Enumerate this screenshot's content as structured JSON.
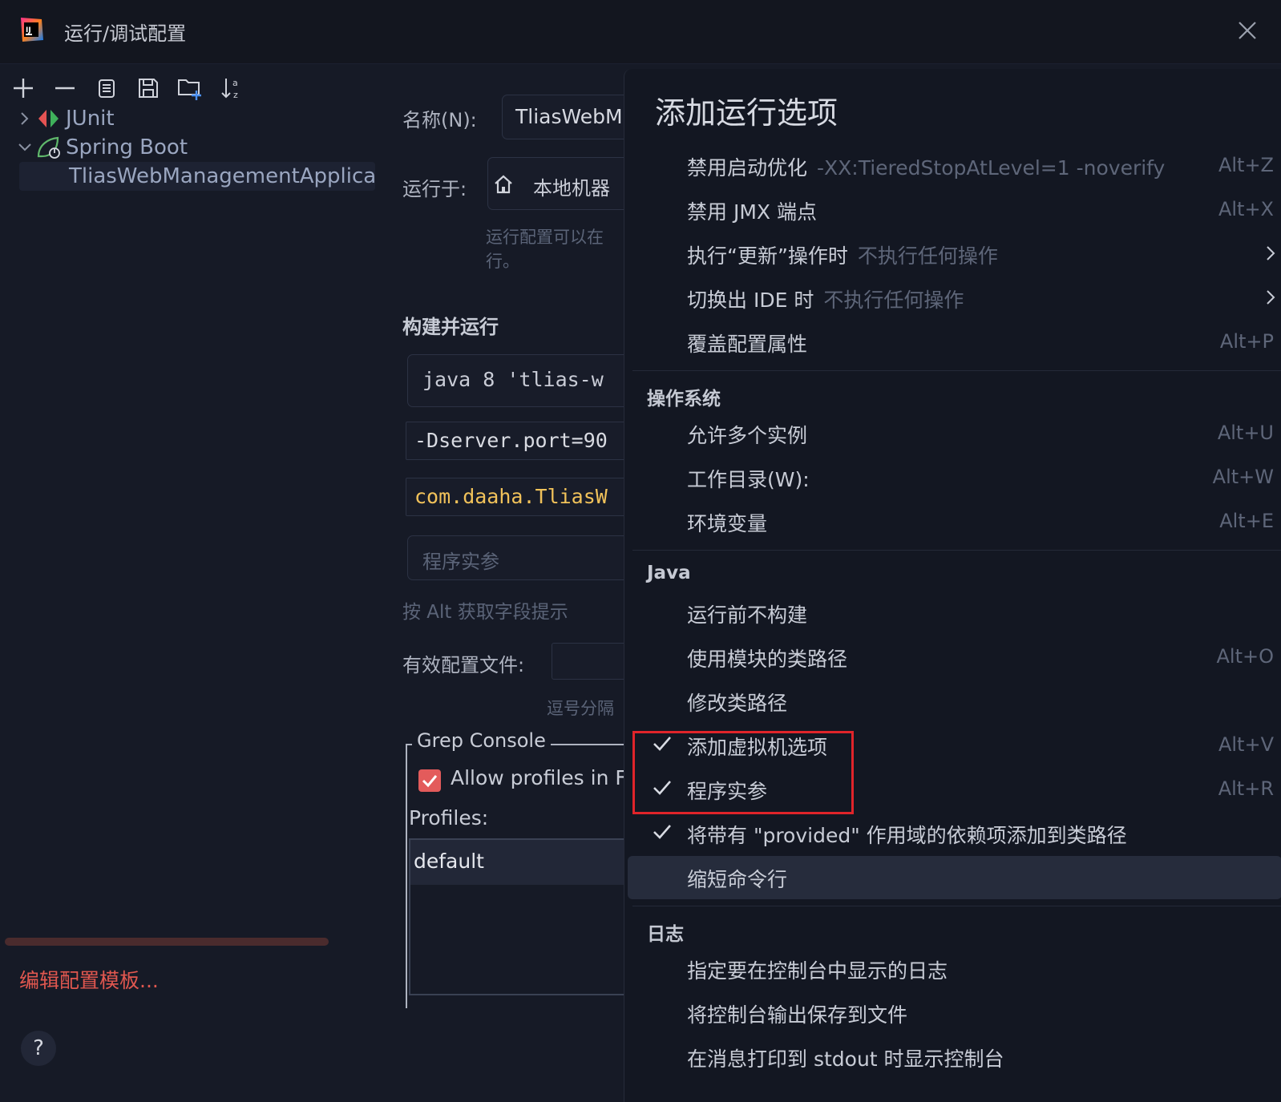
{
  "window": {
    "title": "运行/调试配置"
  },
  "toolbar": {
    "buttons": [
      "add-icon",
      "remove-icon",
      "copy-icon",
      "save-icon",
      "new-folder-icon",
      "sort-icon"
    ]
  },
  "tree": {
    "junit": "JUnit",
    "spring_boot": "Spring Boot",
    "selected_config": "TliasWebManagementApplica"
  },
  "sidebar": {
    "edit_templates": "编辑配置模板...",
    "help": "?"
  },
  "form": {
    "name_label": "名称(N):",
    "name_value": "TliasWebM",
    "run_on_label": "运行于:",
    "run_on_value": "本地机器",
    "run_on_hint_1": "运行配置可以在",
    "run_on_hint_2": "行。",
    "build_run_title": "构建并运行",
    "jdk_value": "java 8 'tlias-w",
    "vm_options_value": "-Dserver.port=90",
    "main_class_value": "com.daaha.TliasW",
    "program_args_placeholder": "程序实参",
    "alt_hint": "按 Alt 获取字段提示",
    "active_profiles_label": "有效配置文件:",
    "comma_hint": "逗号分隔",
    "grep_console_title": "Grep Console",
    "allow_profiles_label": "Allow profiles in F",
    "profiles_label": "Profiles:",
    "profiles_default": "default"
  },
  "popup": {
    "title": "添加运行选项",
    "items_top": [
      {
        "label": "禁用启动优化",
        "sub": "-XX:TieredStopAtLevel=1 -noverify",
        "key": "Alt+Z"
      },
      {
        "label": "禁用 JMX 端点",
        "sub": "",
        "key": "Alt+X"
      },
      {
        "label": "执行“更新”操作时",
        "sub": "不执行任何操作",
        "key": ""
      },
      {
        "label": "切换出 IDE 时",
        "sub": "不执行任何操作",
        "key": ""
      },
      {
        "label": "覆盖配置属性",
        "sub": "",
        "key": "Alt+P"
      }
    ],
    "section_os": "操作系统",
    "items_os": [
      {
        "label": "允许多个实例",
        "key": "Alt+U"
      },
      {
        "label": "工作目录(W):",
        "key": "Alt+W"
      },
      {
        "label": "环境变量",
        "key": "Alt+E"
      }
    ],
    "section_java": "Java",
    "items_java": [
      {
        "label": "运行前不构建",
        "key": "",
        "checked": false
      },
      {
        "label": "使用模块的类路径",
        "key": "Alt+O",
        "checked": false
      },
      {
        "label": "修改类路径",
        "key": "",
        "checked": false
      },
      {
        "label": "添加虚拟机选项",
        "key": "Alt+V",
        "checked": true
      },
      {
        "label": "程序实参",
        "key": "Alt+R",
        "checked": true
      },
      {
        "label": "将带有 \"provided\" 作用域的依赖项添加到类路径",
        "key": "",
        "checked": true
      },
      {
        "label": "缩短命令行",
        "key": "",
        "checked": false
      }
    ],
    "section_log": "日志",
    "items_log": [
      {
        "label": "指定要在控制台中显示的日志"
      },
      {
        "label": "将控制台输出保存到文件"
      },
      {
        "label": "在消息打印到 stdout 时显示控制台"
      }
    ]
  },
  "colors": {
    "accent_red": "#e0574f",
    "highlight_box": "#e0242a",
    "checkbox": "#e35b5b"
  }
}
